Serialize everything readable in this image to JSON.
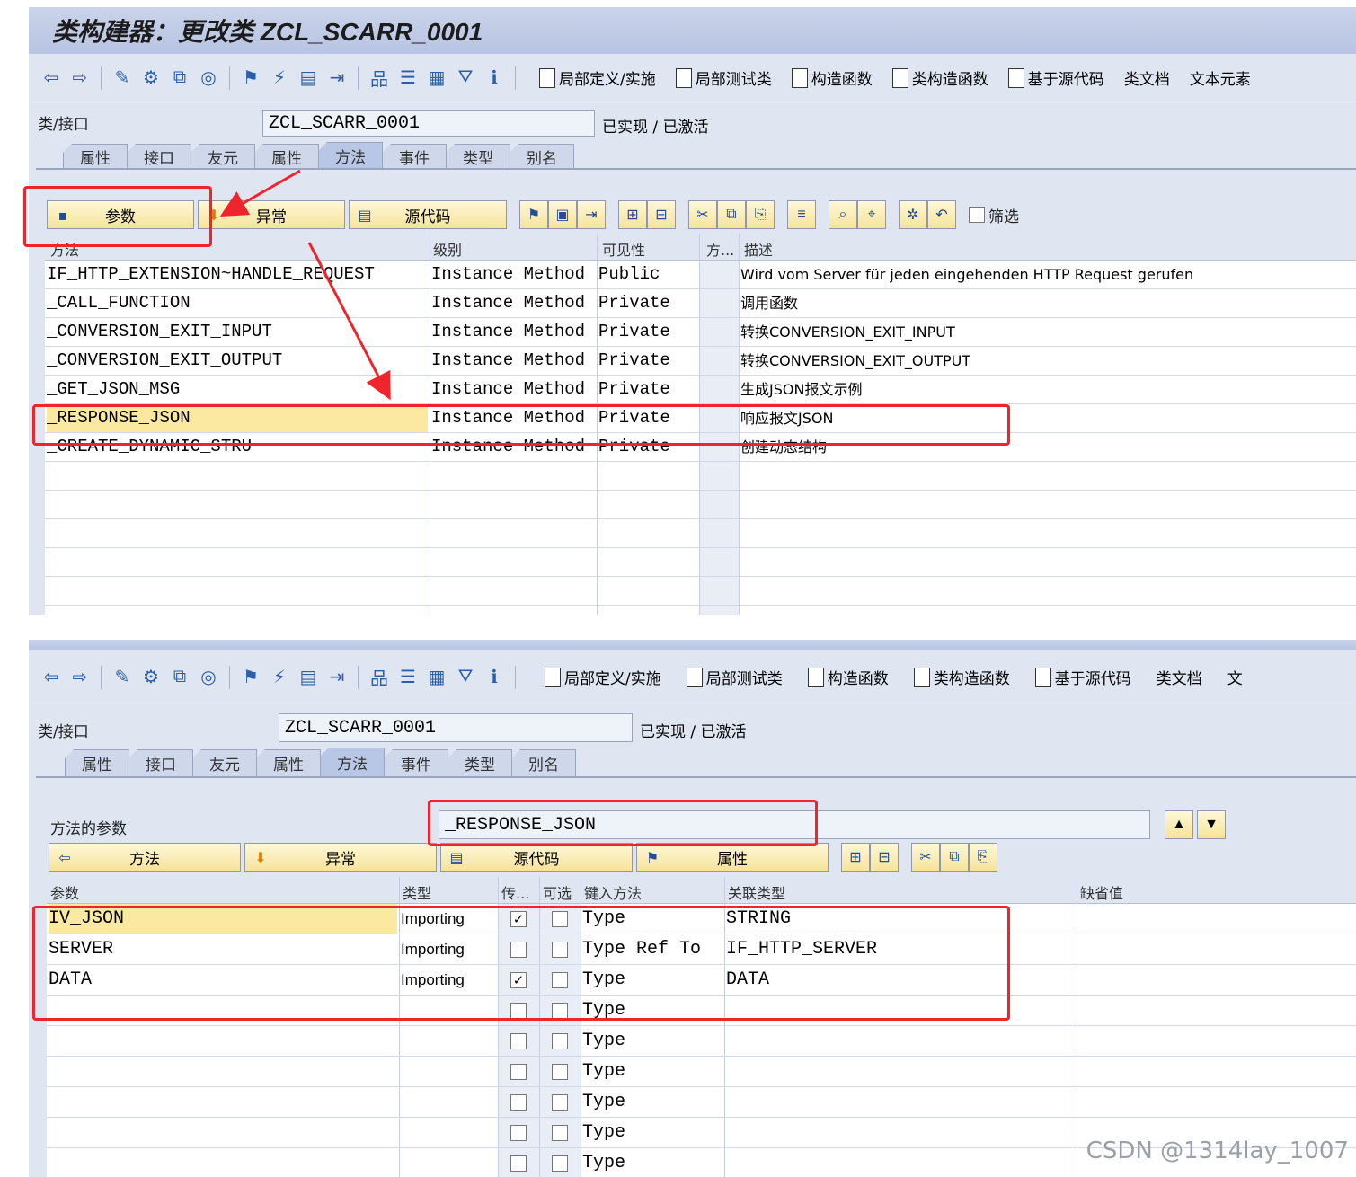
{
  "panel1": {
    "title": "类构建器：更改类 ZCL_SCARR_0001",
    "toolbar": [
      "局部定义/实施",
      "局部测试类",
      "构造函数",
      "类构造函数",
      "基于源代码",
      "类文档",
      "文本元素"
    ],
    "class_label": "类/接口",
    "class_value": "ZCL_SCARR_0001",
    "status": "已实现 / 已激活",
    "tabs": [
      "属性",
      "接口",
      "友元",
      "属性",
      "方法",
      "事件",
      "类型",
      "别名"
    ],
    "active_tab": "方法",
    "buttons": {
      "params": "参数",
      "exceptions": "异常",
      "source": "源代码"
    },
    "filter_label": "筛选",
    "columns": [
      "方法",
      "级别",
      "可见性",
      "方...",
      "描述"
    ],
    "rows": [
      {
        "method": "IF_HTTP_EXTENSION~HANDLE_REQUEST",
        "level": "Instance Method",
        "visibility": "Public",
        "desc": "Wird vom Server für jeden eingehenden HTTP Request gerufen"
      },
      {
        "method": "_CALL_FUNCTION",
        "level": "Instance Method",
        "visibility": "Private",
        "desc": "调用函数"
      },
      {
        "method": "_CONVERSION_EXIT_INPUT",
        "level": "Instance Method",
        "visibility": "Private",
        "desc": "转换CONVERSION_EXIT_INPUT"
      },
      {
        "method": "_CONVERSION_EXIT_OUTPUT",
        "level": "Instance Method",
        "visibility": "Private",
        "desc": "转换CONVERSION_EXIT_OUTPUT"
      },
      {
        "method": "_GET_JSON_MSG",
        "level": "Instance Method",
        "visibility": "Private",
        "desc": "生成JSON报文示例"
      },
      {
        "method": "_RESPONSE_JSON",
        "level": "Instance Method",
        "visibility": "Private",
        "desc": "响应报文JSON"
      },
      {
        "method": "_CREATE_DYNAMIC_STRU",
        "level": "Instance Method",
        "visibility": "Private",
        "desc": "创建动态结构"
      }
    ]
  },
  "panel2": {
    "toolbar": [
      "局部定义/实施",
      "局部测试类",
      "构造函数",
      "类构造函数",
      "基于源代码",
      "类文档",
      "文"
    ],
    "class_label": "类/接口",
    "class_value": "ZCL_SCARR_0001",
    "status": "已实现 / 已激活",
    "tabs": [
      "属性",
      "接口",
      "友元",
      "属性",
      "方法",
      "事件",
      "类型",
      "别名"
    ],
    "params_label": "方法的参数",
    "method_value": "_RESPONSE_JSON",
    "buttons": {
      "method": "方法",
      "exceptions": "异常",
      "source": "源代码",
      "attributes": "属性"
    },
    "columns": [
      "参数",
      "类型",
      "传...",
      "可选",
      "键入方法",
      "关联类型",
      "缺省值"
    ],
    "rows": [
      {
        "param": "IV_JSON",
        "type": "Importing",
        "pass": true,
        "optional": false,
        "typing": "Type",
        "assoc": "STRING"
      },
      {
        "param": "SERVER",
        "type": "Importing",
        "pass": false,
        "optional": false,
        "typing": "Type Ref To",
        "assoc": "IF_HTTP_SERVER"
      },
      {
        "param": "DATA",
        "type": "Importing",
        "pass": true,
        "optional": false,
        "typing": "Type",
        "assoc": "DATA"
      },
      {
        "param": "",
        "type": "",
        "pass": false,
        "optional": false,
        "typing": "Type",
        "assoc": ""
      },
      {
        "param": "",
        "type": "",
        "pass": false,
        "optional": false,
        "typing": "Type",
        "assoc": ""
      },
      {
        "param": "",
        "type": "",
        "pass": false,
        "optional": false,
        "typing": "Type",
        "assoc": ""
      },
      {
        "param": "",
        "type": "",
        "pass": false,
        "optional": false,
        "typing": "Type",
        "assoc": ""
      },
      {
        "param": "",
        "type": "",
        "pass": false,
        "optional": false,
        "typing": "Type",
        "assoc": ""
      },
      {
        "param": "",
        "type": "",
        "pass": false,
        "optional": false,
        "typing": "Type",
        "assoc": ""
      }
    ]
  },
  "watermark": "CSDN @1314lay_1007",
  "colors": {
    "annotation_red": "#f0242c",
    "selection_yellow": "#fbe9a2",
    "panel_bg": "#dfe6f2"
  }
}
